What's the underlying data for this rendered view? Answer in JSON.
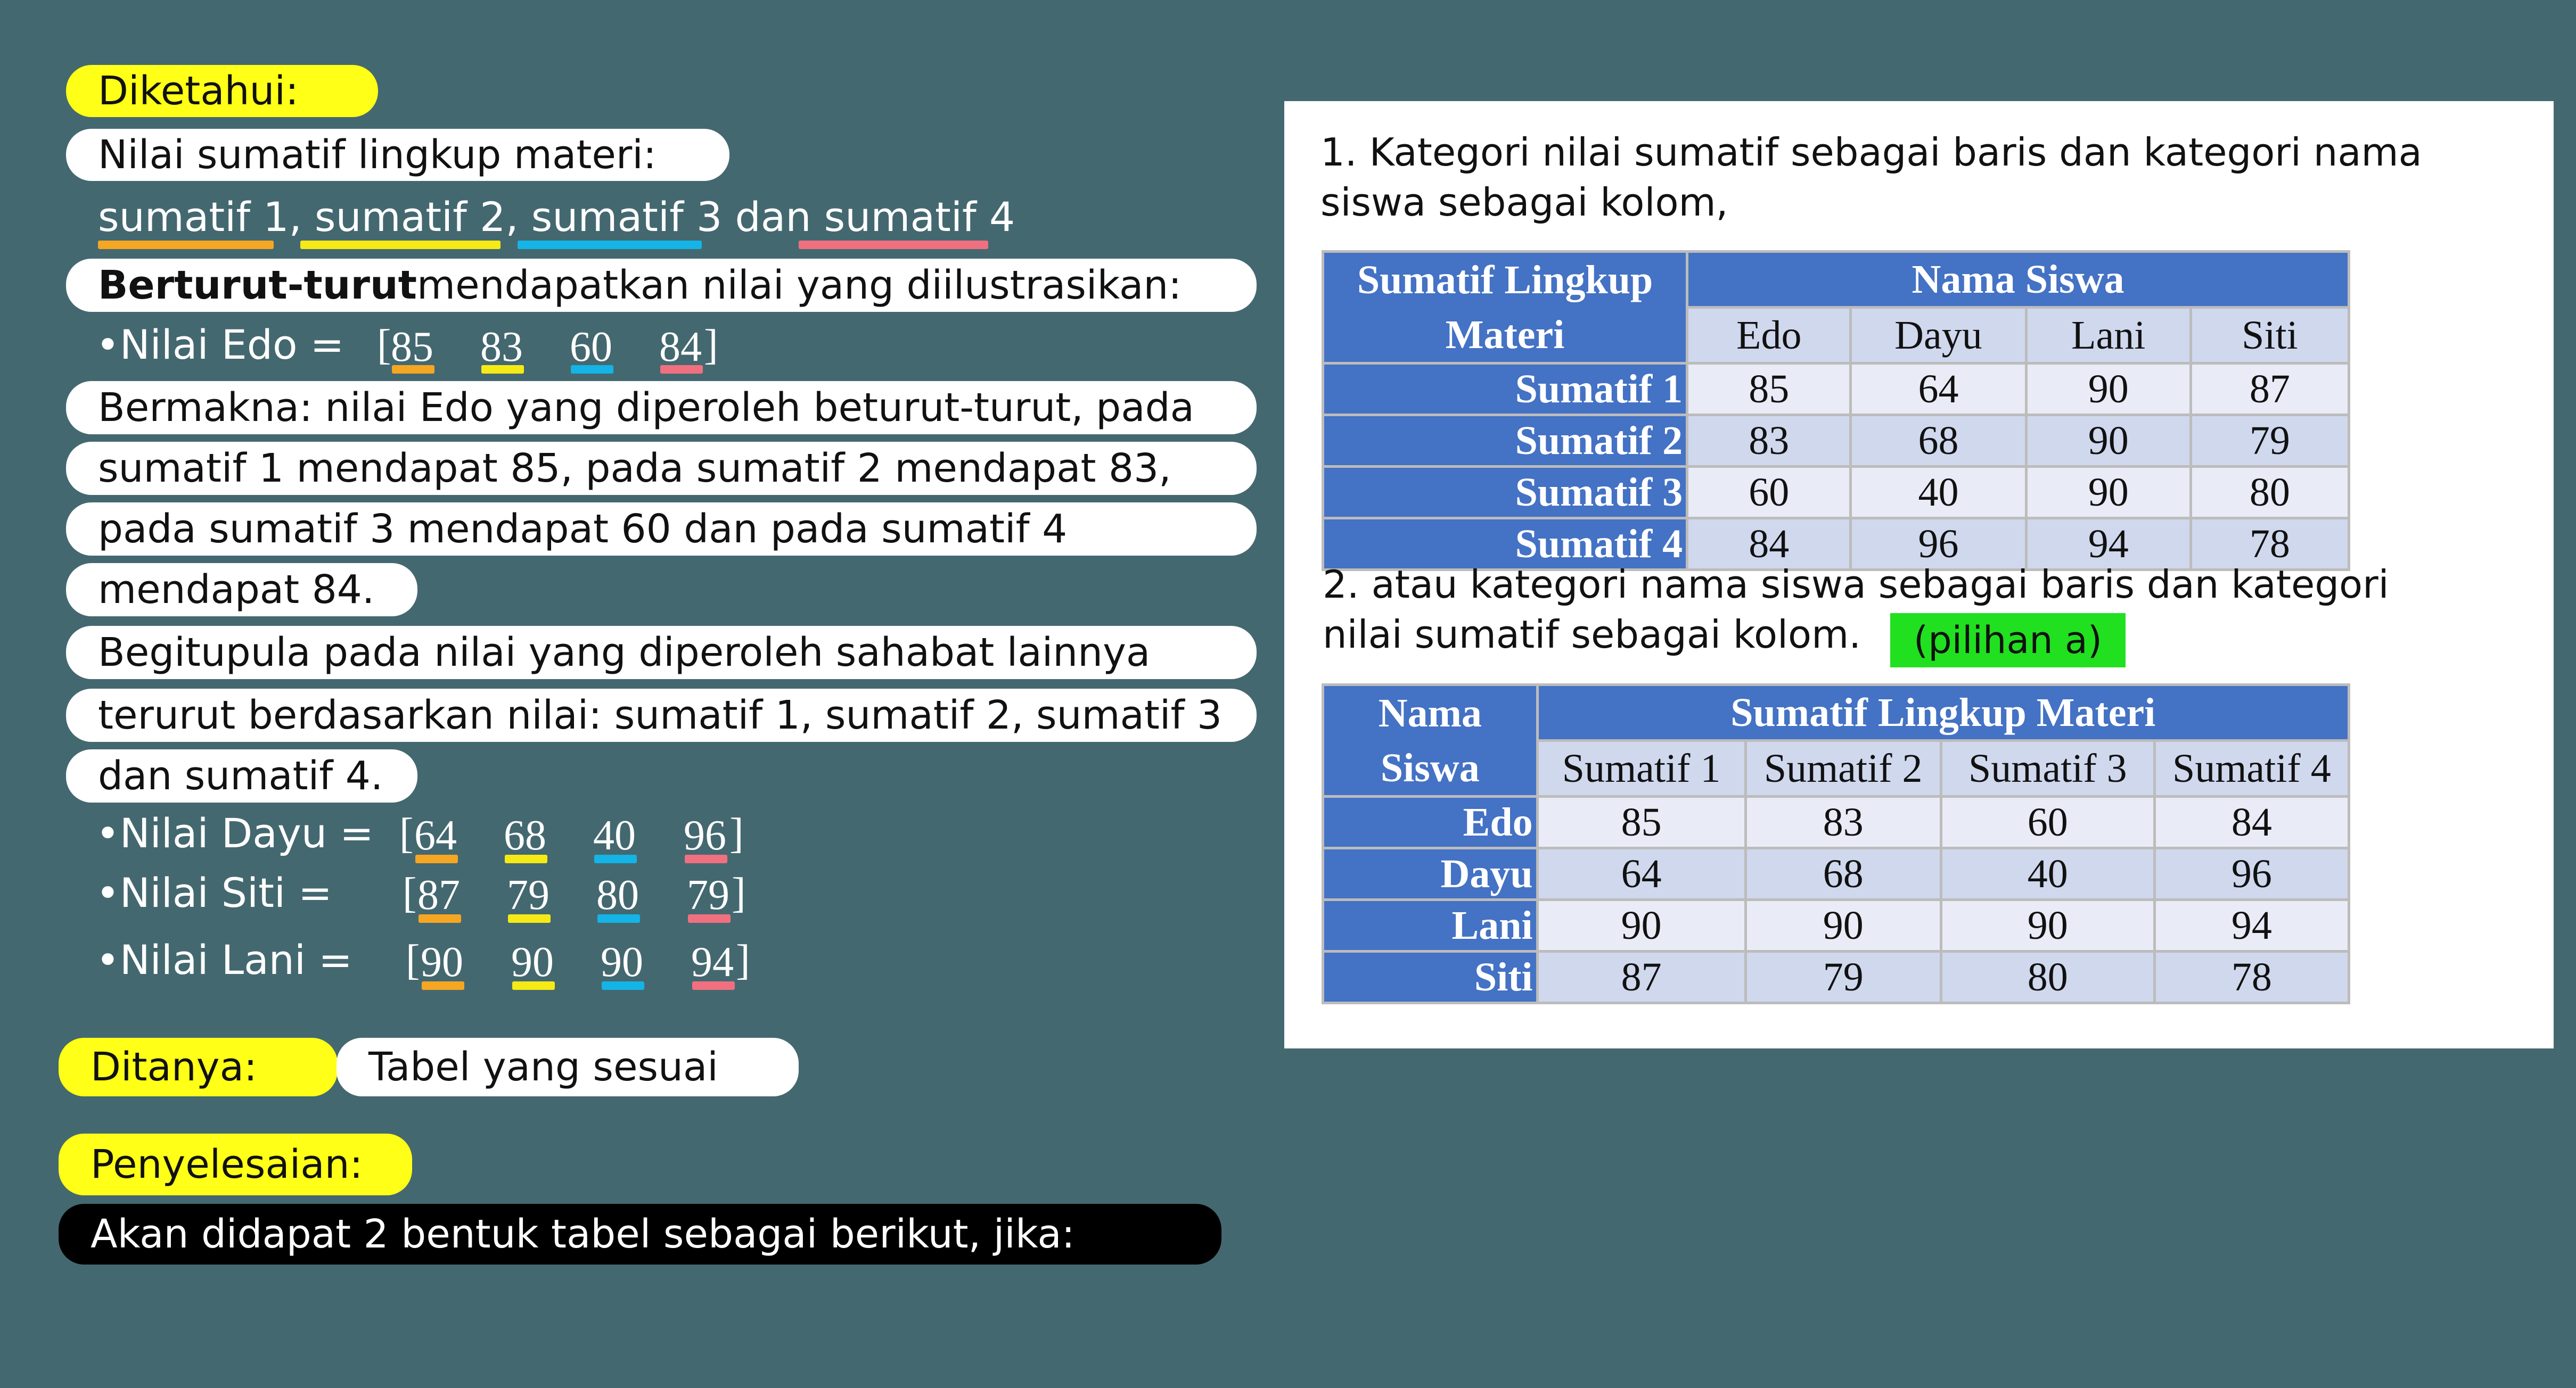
{
  "left": {
    "diketahui": "Diketahui:",
    "nilai_sumatif_label": "Nilai sumatif lingkup materi:",
    "sumatif_line": {
      "s1": "sumatif 1",
      "sep1": ", ",
      "s2": "sumatif 2",
      "sep2": ", ",
      "s3": "sumatif 3",
      "dan": " dan ",
      "s4": "sumatif 4"
    },
    "berturut_bold": "Berturut-turut",
    "berturut_rest": " mendapatkan nilai yang diilustrasikan:",
    "edo": {
      "label": "•Nilai Edo = ",
      "open": "[",
      "close": "]",
      "values": [
        "85",
        "83",
        "60",
        "84"
      ]
    },
    "bermakna_lines": [
      "Bermakna: nilai Edo yang diperoleh beturut-turut, pada",
      "sumatif 1 mendapat 85, pada sumatif 2 mendapat 83,",
      "pada sumatif 3 mendapat 60 dan pada sumatif 4",
      "mendapat 84."
    ],
    "begitupula_lines": [
      "Begitupula pada nilai yang diperoleh sahabat lainnya",
      "terurut berdasarkan nilai: sumatif 1, sumatif 2, sumatif 3",
      "dan sumatif 4."
    ],
    "vectors": [
      {
        "label": "•Nilai Dayu = ",
        "open": "[",
        "close": "]",
        "values": [
          "64",
          "68",
          "40",
          "96"
        ]
      },
      {
        "label": "•Nilai Siti   = ",
        "open": "[",
        "close": "]",
        "values": [
          "87",
          "79",
          "80",
          "79"
        ]
      },
      {
        "label": "•Nilai Lani   = ",
        "open": "[",
        "close": "]",
        "values": [
          "90",
          "90",
          "90",
          "94"
        ]
      }
    ],
    "ditanya": "Ditanya:",
    "tabel_sesuai": "Tabel yang sesuai",
    "penyelesaian": "Penyelesaian:",
    "akan_didapat": "Akan didapat 2 bentuk tabel sebagai berikut, jika:"
  },
  "panel": {
    "item1_line1": "1. Kategori nilai sumatif sebagai baris dan kategori nama",
    "item1_line2": "siswa sebagai kolom,",
    "table1": {
      "corner": "Sumatif Lingkup Materi",
      "group_header": "Nama Siswa",
      "columns": [
        "Edo",
        "Dayu",
        "Lani",
        "Siti"
      ],
      "rows": [
        {
          "label": "Sumatif 1",
          "cells": [
            "85",
            "64",
            "90",
            "87"
          ]
        },
        {
          "label": "Sumatif 2",
          "cells": [
            "83",
            "68",
            "90",
            "79"
          ]
        },
        {
          "label": "Sumatif 3",
          "cells": [
            "60",
            "40",
            "90",
            "80"
          ]
        },
        {
          "label": "Sumatif 4",
          "cells": [
            "84",
            "96",
            "94",
            "78"
          ]
        }
      ]
    },
    "item2_line1": "2. atau kategori nama siswa sebagai baris dan kategori",
    "item2_line2": "nilai sumatif sebagai kolom.",
    "pilihan": "(pilihan a)",
    "table2": {
      "corner": "Nama Siswa",
      "group_header": "Sumatif  Lingkup Materi",
      "columns": [
        "Sumatif 1",
        "Sumatif 2",
        "Sumatif 3",
        "Sumatif 4"
      ],
      "rows": [
        {
          "label": "Edo",
          "cells": [
            "85",
            "83",
            "60",
            "84"
          ]
        },
        {
          "label": "Dayu",
          "cells": [
            "64",
            "68",
            "40",
            "96"
          ]
        },
        {
          "label": "Lani",
          "cells": [
            "90",
            "90",
            "90",
            "94"
          ]
        },
        {
          "label": "Siti",
          "cells": [
            "87",
            "79",
            "80",
            "78"
          ]
        }
      ]
    }
  },
  "colors": {
    "background": "#446870",
    "highlight_yellow": "#ffff17",
    "sumatif1": "#f5a623",
    "sumatif2": "#f5ea16",
    "sumatif3": "#14b4e6",
    "sumatif4": "#f07080",
    "table_header": "#4472c4",
    "pilihan_green": "#21e020"
  }
}
